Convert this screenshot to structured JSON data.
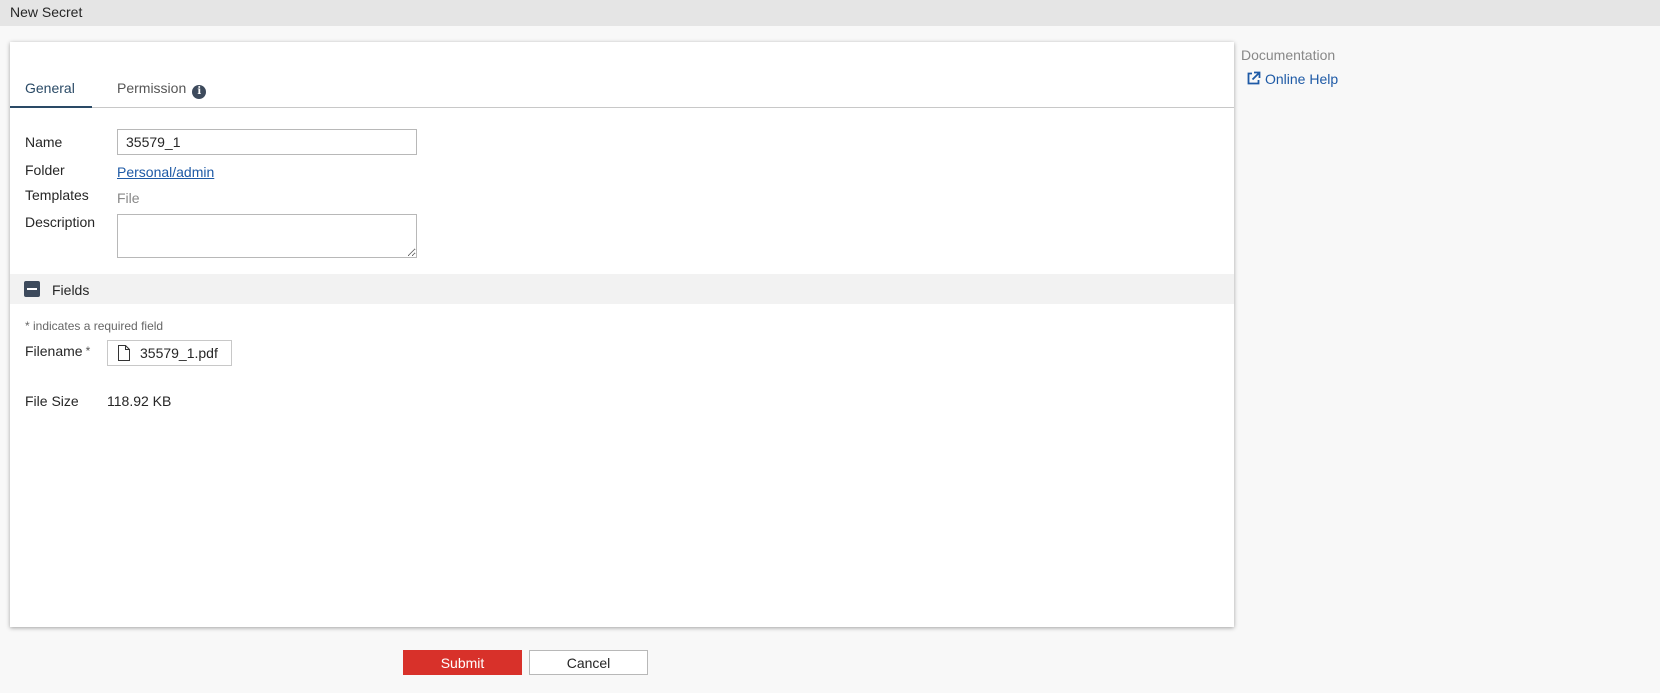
{
  "titlebar": {
    "title": "New Secret"
  },
  "tabs": [
    {
      "label": "General",
      "active": true
    },
    {
      "label": "Permission",
      "active": false
    }
  ],
  "general": {
    "name_label": "Name",
    "name_value": "35579_1",
    "folder_label": "Folder",
    "folder_value": "Personal/admin",
    "templates_label": "Templates",
    "templates_value": "File",
    "description_label": "Description",
    "description_value": ""
  },
  "fields": {
    "section_label": "Fields",
    "required_note": "*  indicates a required field",
    "filename_label": "Filename",
    "required_marker": "*",
    "filename_value": "35579_1.pdf",
    "filesize_label": "File Size",
    "filesize_value": "118.92 KB"
  },
  "sidebar": {
    "documentation_title": "Documentation",
    "online_help_label": "Online Help"
  },
  "buttons": {
    "submit_label": "Submit",
    "cancel_label": "Cancel"
  },
  "icons": {
    "info": "info-icon",
    "collapse": "minus-square-icon",
    "file": "file-icon",
    "external_link": "external-link-icon"
  },
  "colors": {
    "accent": "#2a4a66",
    "link": "#1e5aa6",
    "submit": "#d8312a"
  }
}
